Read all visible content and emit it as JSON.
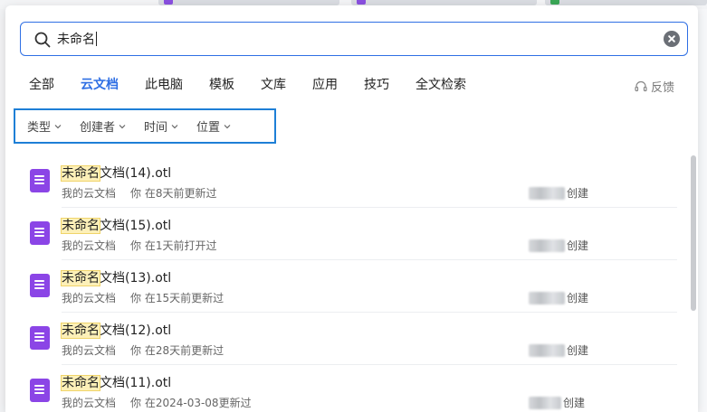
{
  "search": {
    "value": "未命名",
    "icon": "search-icon"
  },
  "tabs": [
    {
      "label": "全部",
      "active": false
    },
    {
      "label": "云文档",
      "active": true
    },
    {
      "label": "此电脑",
      "active": false
    },
    {
      "label": "模板",
      "active": false
    },
    {
      "label": "文库",
      "active": false
    },
    {
      "label": "应用",
      "active": false
    },
    {
      "label": "技巧",
      "active": false
    },
    {
      "label": "全文检索",
      "active": false
    }
  ],
  "feedback_label": "反馈",
  "filters": [
    {
      "label": "类型"
    },
    {
      "label": "创建者"
    },
    {
      "label": "时间"
    },
    {
      "label": "位置"
    }
  ],
  "results": [
    {
      "highlight": "未命名",
      "rest": "文档(14).otl",
      "location": "我的云文档",
      "activity": "你 在8天前更新过",
      "creator_suffix": "创建"
    },
    {
      "highlight": "未命名",
      "rest": "文档(15).otl",
      "location": "我的云文档",
      "activity": "你 在1天前打开过",
      "creator_suffix": "创建"
    },
    {
      "highlight": "未命名",
      "rest": "文档(13).otl",
      "location": "我的云文档",
      "activity": "你 在15天前更新过",
      "creator_suffix": "创建"
    },
    {
      "highlight": "未命名",
      "rest": "文档(12).otl",
      "location": "我的云文档",
      "activity": "你 在28天前更新过",
      "creator_suffix": "创建"
    },
    {
      "highlight": "未命名",
      "rest": "文档(11).otl",
      "location": "我的云文档",
      "activity": "你 在2024-03-08更新过",
      "creator_suffix": "创建"
    }
  ],
  "colors": {
    "accent": "#2f6fe4",
    "doc_icon": "#8b45e6",
    "highlight": "#fdf0b8",
    "filter_border": "#1e7fd6"
  }
}
